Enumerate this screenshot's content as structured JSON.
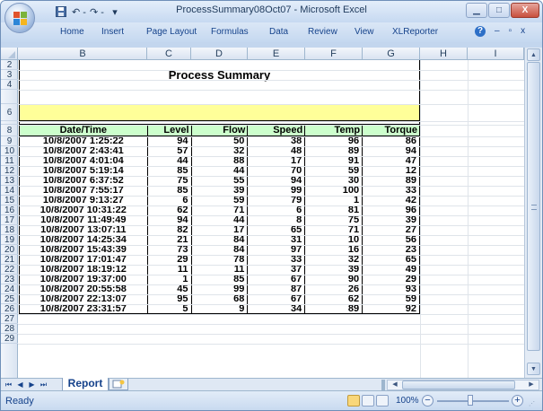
{
  "window": {
    "title": "ProcessSummary08Oct07 - Microsoft Excel",
    "controls": {
      "minimize": "▁",
      "maximize": "□",
      "close": "X"
    }
  },
  "qat": {
    "save_icon": "save-icon",
    "undo": "↶ -",
    "redo": "↷ -",
    "more": "▾"
  },
  "ribbon": {
    "tabs": [
      "Home",
      "Insert",
      "Page Layout",
      "Formulas",
      "Data",
      "Review",
      "View",
      "XLReporter"
    ],
    "help": "?",
    "minimize": "–",
    "restore": "▫",
    "close": "x"
  },
  "columns": [
    "B",
    "C",
    "D",
    "E",
    "F",
    "G",
    "H",
    "I"
  ],
  "rows": [
    "2",
    "3",
    "4",
    "",
    "6",
    "",
    "8",
    "9",
    "10",
    "11",
    "12",
    "13",
    "14",
    "15",
    "16",
    "17",
    "18",
    "19",
    "20",
    "21",
    "22",
    "23",
    "24",
    "25",
    "26",
    "27",
    "28",
    "29"
  ],
  "sheet": {
    "title": "Process Summary",
    "headers": [
      "Date/Time",
      "Level",
      "Flow",
      "Speed",
      "Temp",
      "Torque"
    ],
    "data": [
      [
        "10/8/2007 1:25:22",
        "94",
        "50",
        "38",
        "96",
        "86"
      ],
      [
        "10/8/2007 2:43:41",
        "57",
        "32",
        "48",
        "89",
        "94"
      ],
      [
        "10/8/2007 4:01:04",
        "44",
        "88",
        "17",
        "91",
        "47"
      ],
      [
        "10/8/2007 5:19:14",
        "85",
        "44",
        "70",
        "59",
        "12"
      ],
      [
        "10/8/2007 6:37:52",
        "75",
        "55",
        "94",
        "30",
        "89"
      ],
      [
        "10/8/2007 7:55:17",
        "85",
        "39",
        "99",
        "100",
        "33"
      ],
      [
        "10/8/2007 9:13:27",
        "6",
        "59",
        "79",
        "1",
        "42"
      ],
      [
        "10/8/2007 10:31:22",
        "62",
        "71",
        "6",
        "81",
        "96"
      ],
      [
        "10/8/2007 11:49:49",
        "94",
        "44",
        "8",
        "75",
        "39"
      ],
      [
        "10/8/2007 13:07:11",
        "82",
        "17",
        "65",
        "71",
        "27"
      ],
      [
        "10/8/2007 14:25:34",
        "21",
        "84",
        "31",
        "10",
        "56"
      ],
      [
        "10/8/2007 15:43:39",
        "73",
        "84",
        "97",
        "16",
        "23"
      ],
      [
        "10/8/2007 17:01:47",
        "29",
        "78",
        "33",
        "32",
        "65"
      ],
      [
        "10/8/2007 18:19:12",
        "11",
        "11",
        "37",
        "39",
        "49"
      ],
      [
        "10/8/2007 19:37:00",
        "1",
        "85",
        "67",
        "90",
        "29"
      ],
      [
        "10/8/2007 20:55:58",
        "45",
        "99",
        "87",
        "26",
        "93"
      ],
      [
        "10/8/2007 22:13:07",
        "95",
        "68",
        "67",
        "62",
        "59"
      ],
      [
        "10/8/2007 23:31:57",
        "5",
        "9",
        "34",
        "89",
        "92"
      ]
    ]
  },
  "sheet_tabs": {
    "active": "Report",
    "nav": [
      "⏮",
      "◀",
      "▶",
      "⏭"
    ]
  },
  "statusbar": {
    "status": "Ready",
    "zoom": "100%",
    "minus": "−",
    "plus": "+"
  },
  "colors": {
    "header_fill": "#ccffcc",
    "band_fill": "#ffff99",
    "ui_blue": "#15428b"
  }
}
